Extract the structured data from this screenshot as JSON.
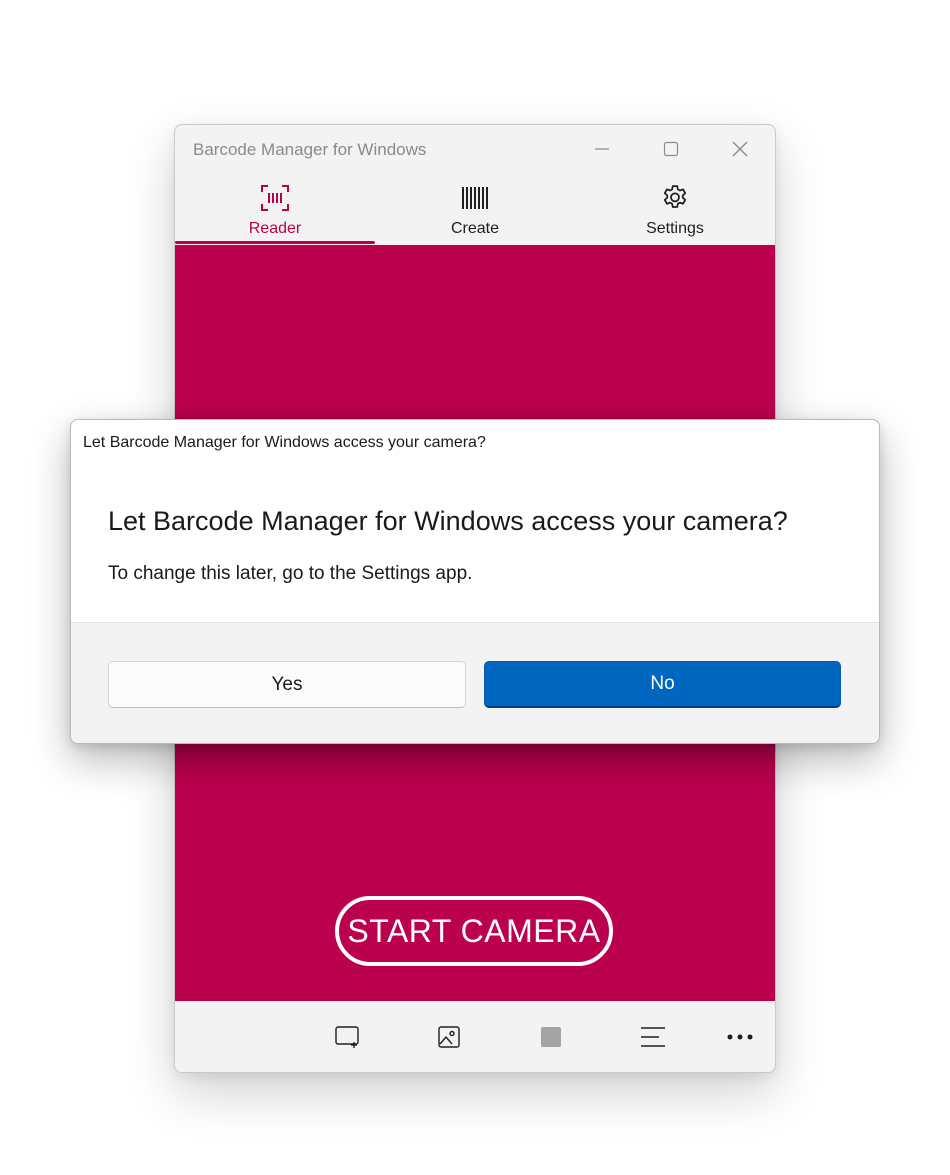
{
  "app": {
    "title": "Barcode Manager for Windows",
    "accent_color": "#bb004e"
  },
  "window_controls": {
    "minimize_icon": "minimize-icon",
    "maximize_icon": "maximize-icon",
    "close_icon": "close-icon"
  },
  "tabs": [
    {
      "label": "Reader",
      "icon": "barcode-scan-icon",
      "active": true
    },
    {
      "label": "Create",
      "icon": "barcode-icon",
      "active": false
    },
    {
      "label": "Settings",
      "icon": "gear-icon",
      "active": false
    }
  ],
  "main": {
    "start_camera_label": "START CAMERA"
  },
  "bottombar": {
    "items": [
      {
        "icon": "add-region-icon"
      },
      {
        "icon": "image-icon"
      },
      {
        "icon": "stop-icon"
      },
      {
        "icon": "list-icon"
      },
      {
        "icon": "more-icon"
      }
    ]
  },
  "dialog": {
    "caption": "Let Barcode Manager for Windows access your camera?",
    "heading": "Let Barcode Manager for Windows access your camera?",
    "subtext": "To change this later, go to the Settings app.",
    "yes_label": "Yes",
    "no_label": "No",
    "primary_color": "#0067c0"
  }
}
